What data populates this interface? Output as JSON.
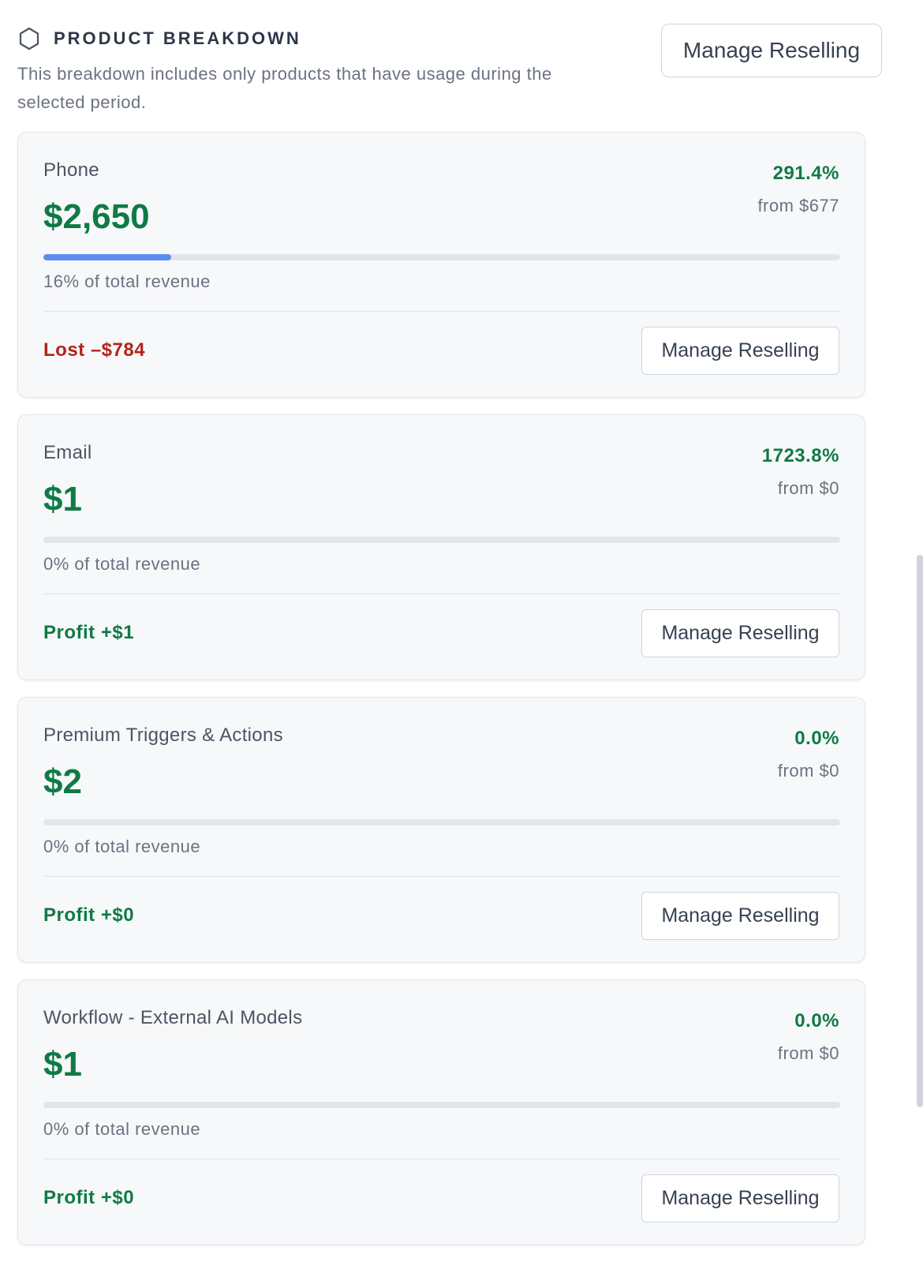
{
  "header": {
    "icon": "hexagon-icon",
    "title": "PRODUCT BREAKDOWN",
    "subtitle": "This breakdown includes only products that have usage during the selected period.",
    "manage_button_label": "Manage Reselling"
  },
  "colors": {
    "positive": "#0f7a45",
    "negative": "#b42318",
    "progress": "#5b8def"
  },
  "products": [
    {
      "name": "Phone",
      "amount": "$2,650",
      "change_pct": "291.4%",
      "from": "from $677",
      "revenue_share_fraction": 0.16,
      "revenue_share_text": "16% of total revenue",
      "status_text": "Lost –$784",
      "status_type": "lost",
      "button_label": "Manage Reselling"
    },
    {
      "name": "Email",
      "amount": "$1",
      "change_pct": "1723.8%",
      "from": "from $0",
      "revenue_share_fraction": 0,
      "revenue_share_text": "0% of total revenue",
      "status_text": "Profit +$1",
      "status_type": "profit",
      "button_label": "Manage Reselling"
    },
    {
      "name": "Premium Triggers & Actions",
      "amount": "$2",
      "change_pct": "0.0%",
      "from": "from $0",
      "revenue_share_fraction": 0,
      "revenue_share_text": "0% of total revenue",
      "status_text": "Profit +$0",
      "status_type": "profit",
      "button_label": "Manage Reselling"
    },
    {
      "name": "Workflow - External AI Models",
      "amount": "$1",
      "change_pct": "0.0%",
      "from": "from $0",
      "revenue_share_fraction": 0,
      "revenue_share_text": "0% of total revenue",
      "status_text": "Profit +$0",
      "status_type": "profit",
      "button_label": "Manage Reselling"
    }
  ]
}
